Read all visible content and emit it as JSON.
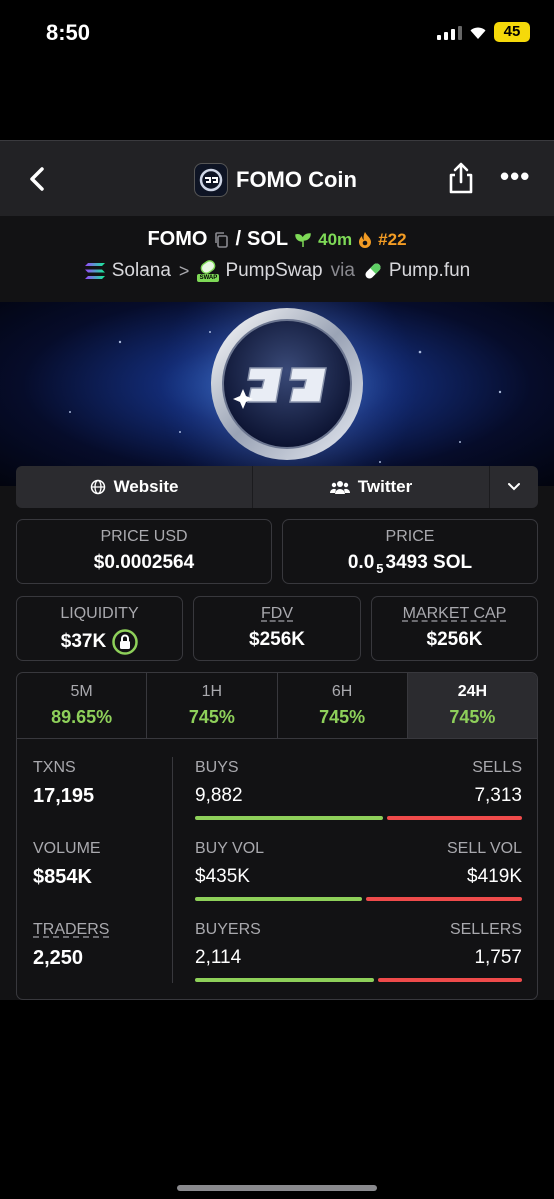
{
  "status_bar": {
    "time": "8:50",
    "battery": "45"
  },
  "header": {
    "title": "FOMO Coin"
  },
  "pair": {
    "base": "FOMO",
    "separator": "/",
    "quote": "SOL",
    "age": "40m",
    "rank": "#22",
    "chain": "Solana",
    "dex": "PumpSwap",
    "dex_badge": "SWAP",
    "via": "via",
    "launchpad": "Pump.fun"
  },
  "links": {
    "website": "Website",
    "twitter": "Twitter"
  },
  "price_usd": {
    "label": "PRICE USD",
    "value": "$0.0002564"
  },
  "price_native": {
    "label": "PRICE",
    "prefix": "0.0",
    "zeros": "5",
    "suffix": "3493 SOL"
  },
  "liquidity": {
    "label": "LIQUIDITY",
    "value": "$37K"
  },
  "fdv": {
    "label": "FDV",
    "value": "$256K"
  },
  "market_cap": {
    "label": "MARKET CAP",
    "value": "$256K"
  },
  "timeframes": [
    {
      "label": "5M",
      "value": "89.65%"
    },
    {
      "label": "1H",
      "value": "745%"
    },
    {
      "label": "6H",
      "value": "745%"
    },
    {
      "label": "24H",
      "value": "745%"
    }
  ],
  "active_timeframe": "24H",
  "stats": {
    "txns": {
      "label": "TXNS",
      "value": "17,195"
    },
    "volume": {
      "label": "VOLUME",
      "value": "$854K"
    },
    "traders": {
      "label": "TRADERS",
      "value": "2,250"
    },
    "buys": {
      "label": "BUYS",
      "value": "9,882",
      "share": 0.575
    },
    "sells": {
      "label": "SELLS",
      "value": "7,313"
    },
    "buy_vol": {
      "label": "BUY VOL",
      "value": "$435K",
      "share": 0.51
    },
    "sell_vol": {
      "label": "SELL VOL",
      "value": "$419K"
    },
    "buyers": {
      "label": "BUYERS",
      "value": "2,114",
      "share": 0.546
    },
    "sellers": {
      "label": "SELLERS",
      "value": "1,757"
    }
  },
  "colors": {
    "positive": "#8ed05a",
    "negative": "#ef4b4b",
    "accent_rank": "#f39c24"
  }
}
